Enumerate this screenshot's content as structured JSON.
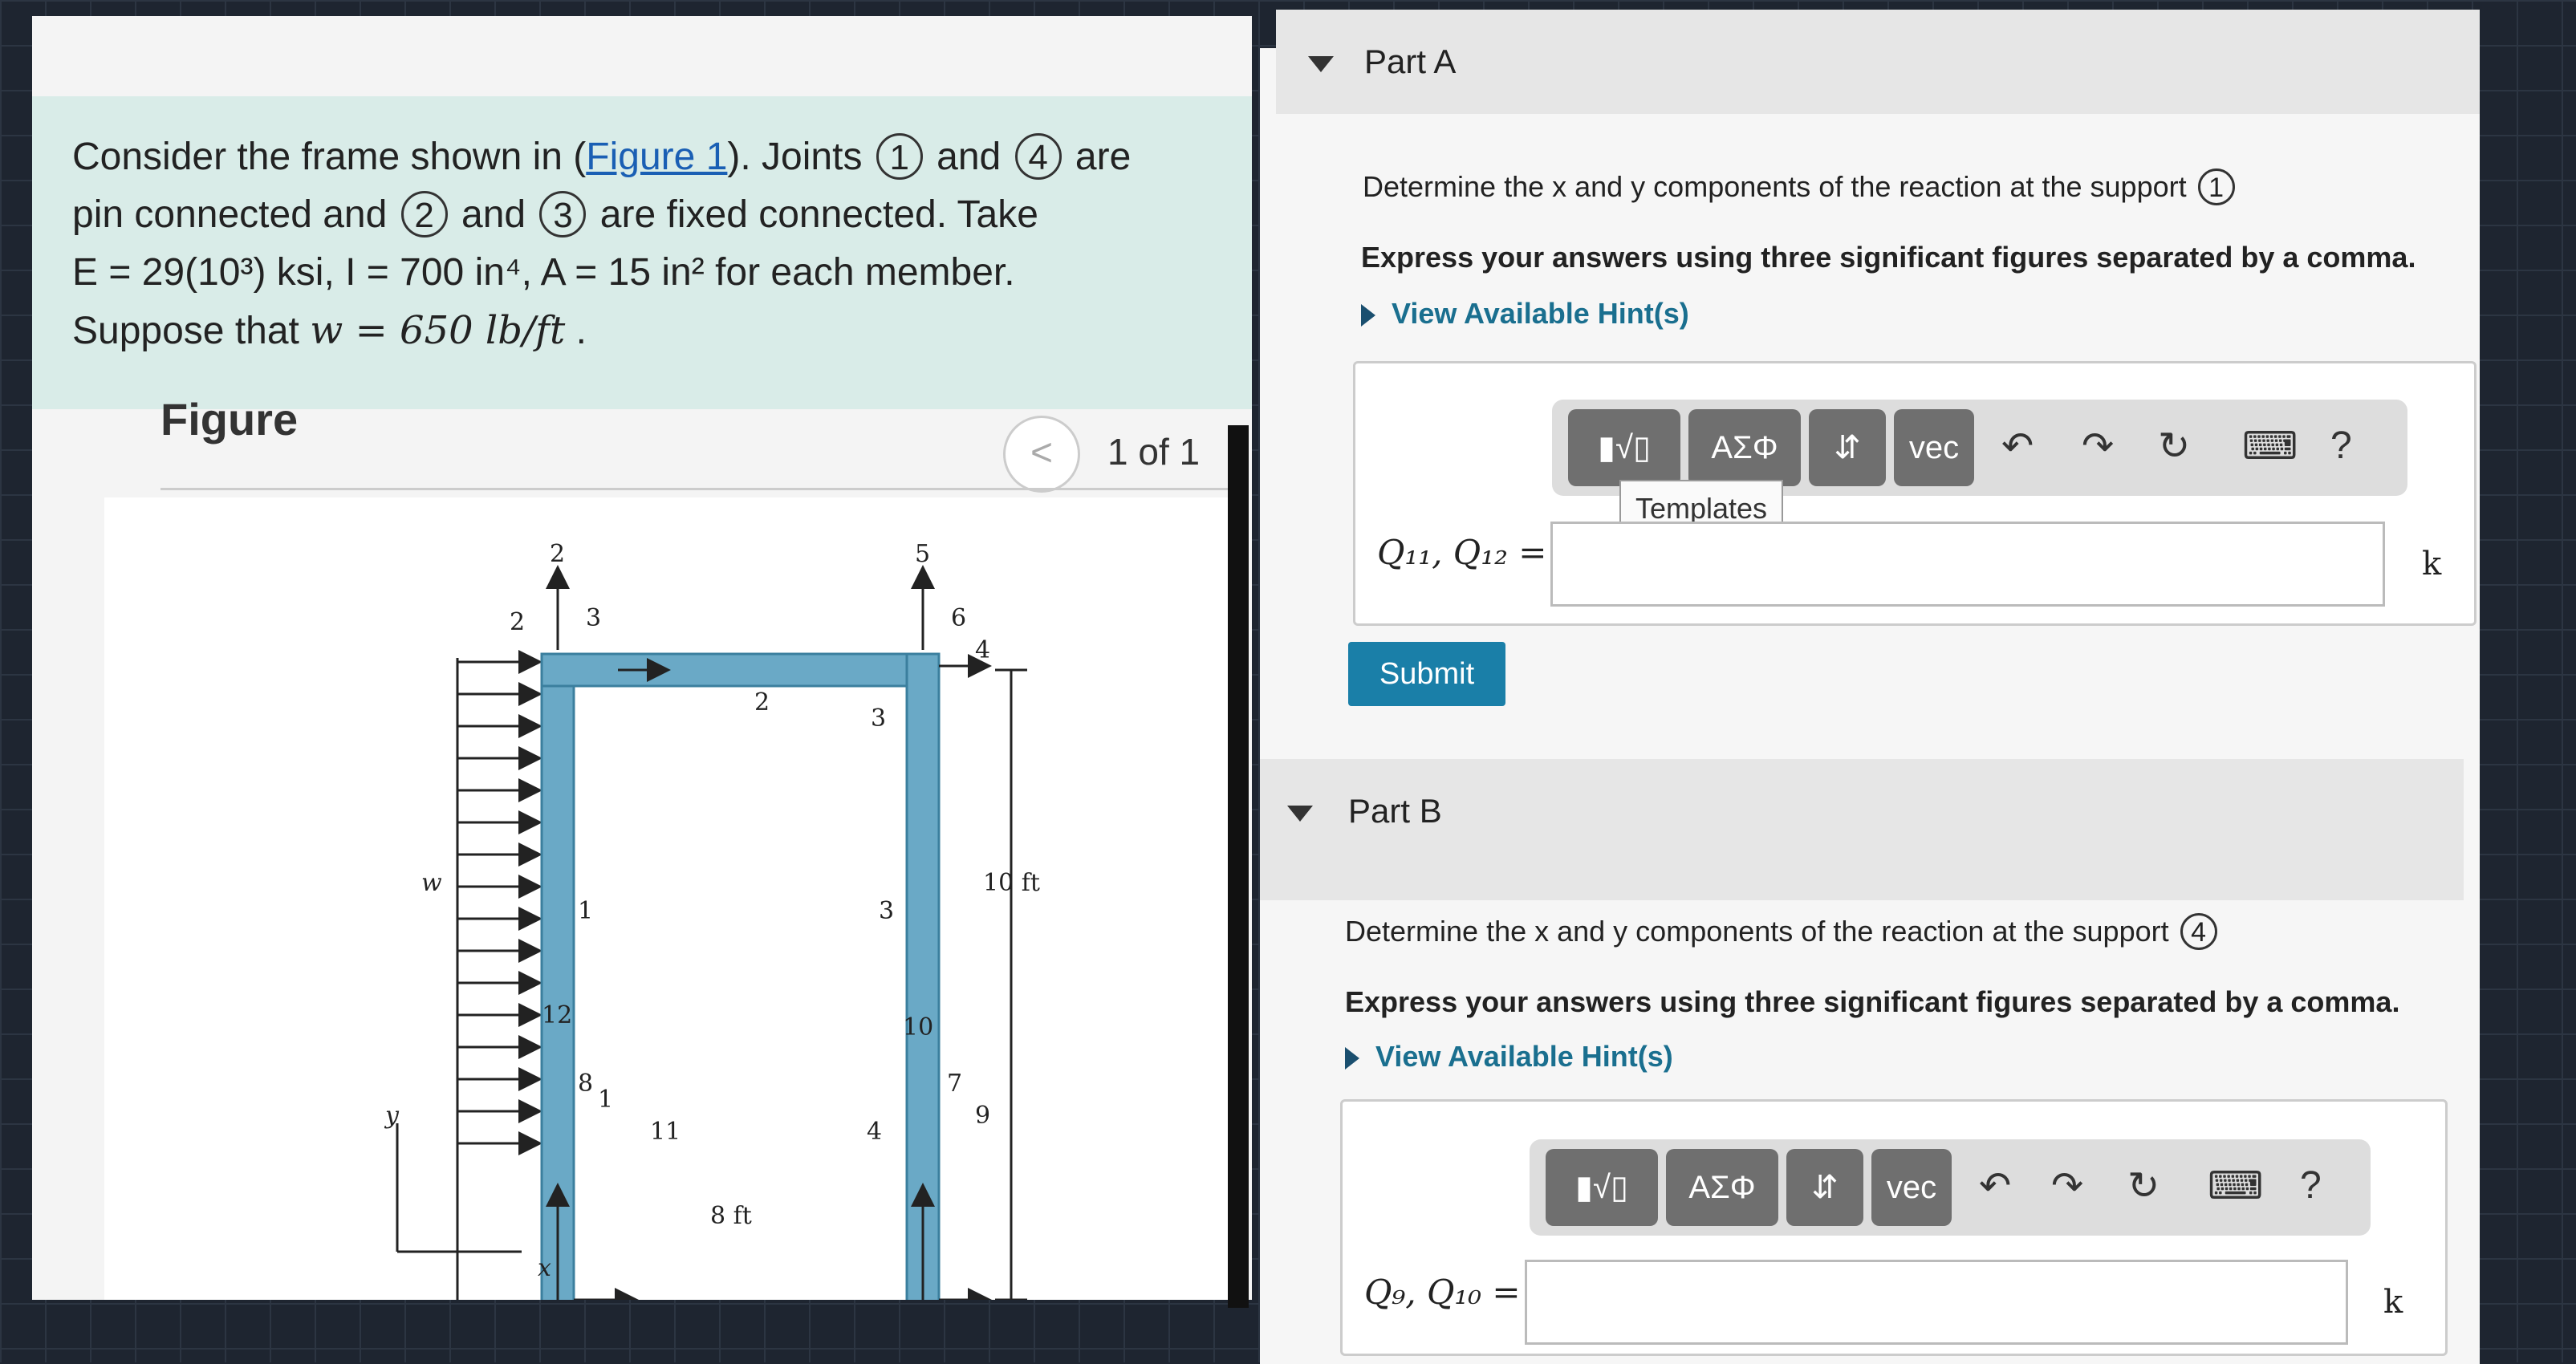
{
  "problem": {
    "line1_a": "Consider the frame shown in (",
    "figure_link": "Figure 1",
    "line1_b": "). Joints",
    "joint1": "1",
    "and": "and",
    "joint4": "4",
    "are": "are",
    "line2_a": "pin connected and",
    "joint2": "2",
    "joint3": "3",
    "line2_b": "are fixed connected. Take",
    "line3": "E = 29(10³) ksi, I = 700 in⁴, A = 15 in² for each member.",
    "line4_a": "Suppose that",
    "w_expr": "w = 650 lb/ft",
    "line4_b": "."
  },
  "figure": {
    "title": "Figure",
    "pager_prev": "<",
    "pager_text": "1 of 1",
    "labels": {
      "w": "w",
      "y": "y",
      "x": "x",
      "dim_height": "10 ft",
      "dim_width": "8 ft",
      "member1": "1",
      "member2": "2",
      "member3": "3",
      "node1": "1",
      "node2": "2",
      "node3": "3",
      "node4": "4",
      "c2": "2",
      "c3": "3",
      "c4": "4",
      "c5": "5",
      "c6": "6",
      "c7": "7",
      "c8": "8",
      "c9": "9",
      "c10": "10",
      "c11": "11",
      "c12": "12"
    }
  },
  "partA": {
    "title": "Part A",
    "question": "Determine the x and y components of the reaction at the support",
    "support": "1",
    "instruction": "Express your answers using three significant figures separated by a comma.",
    "hint": "View Available Hint(s)",
    "label": "Q₁₁, Q₁₂ =",
    "unit": "k",
    "submit": "Submit",
    "tooltip": "Templates"
  },
  "partB": {
    "title": "Part B",
    "question": "Determine the x and y components of the reaction at the support",
    "support": "4",
    "instruction": "Express your answers using three significant figures separated by a comma.",
    "hint": "View Available Hint(s)",
    "label": "Q₉, Q₁₀ =",
    "unit": "k"
  },
  "toolbar": {
    "templates_icon": "▮√▯",
    "greek": "ΑΣΦ",
    "arrows": "⇵",
    "vec": "vec",
    "undo": "↶",
    "redo": "↷",
    "reset": "↻",
    "keyboard": "⌨",
    "help": "?"
  }
}
